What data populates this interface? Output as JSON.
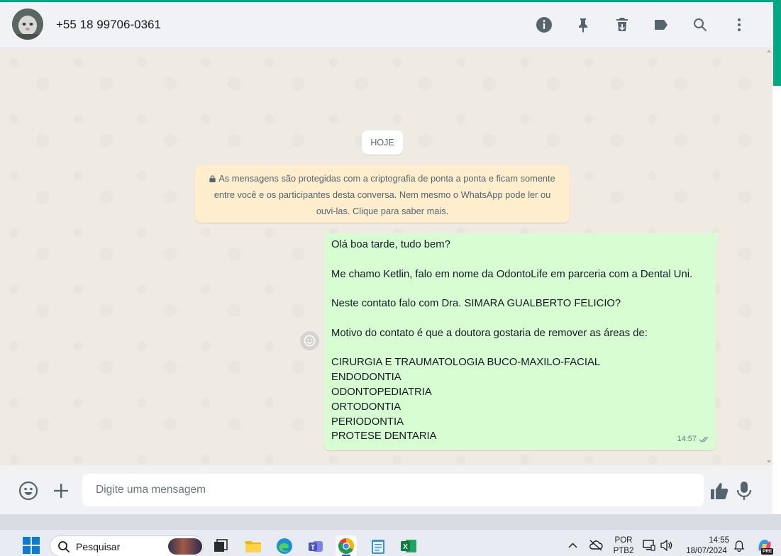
{
  "header": {
    "contact_name": "+55 18 99706-0361"
  },
  "chat": {
    "date_chip": "HOJE",
    "encryption_notice": "As mensagens são protegidas com a criptografia de ponta a ponta e ficam somente entre você e os participantes desta conversa. Nem mesmo o WhatsApp pode ler ou ouvi-las. Clique para saber mais.",
    "message": {
      "lines": [
        "Olá boa tarde, tudo bem?",
        "",
        "Me chamo Ketlin, falo em nome da OdontoLife em parceria com a Dental Uni.",
        "",
        "Neste contato falo com Dra. SIMARA GUALBERTO FELICIO?",
        "",
        "Motivo do contato é que a doutora gostaria de remover as áreas de:",
        "",
        "CIRURGIA E TRAUMATOLOGIA BUCO-MAXILO-FACIAL",
        "ENDODONTIA",
        "ODONTOPEDIATRIA",
        "ORTODONTIA",
        "PERIODONTIA",
        "PROTESE DENTARIA"
      ],
      "time": "14:57"
    }
  },
  "composer": {
    "placeholder": "Digite uma mensagem"
  },
  "taskbar": {
    "search_label": "Pesquisar",
    "language_top": "POR",
    "language_bottom": "PTB2",
    "time": "14:55",
    "date": "18/07/2024",
    "copilot_badge": "PRE"
  },
  "colors": {
    "accent": "#00a884",
    "outgoing_bubble": "#d9fdd3",
    "notice_bg": "#ffeecd",
    "chat_bg": "#efeae2"
  }
}
